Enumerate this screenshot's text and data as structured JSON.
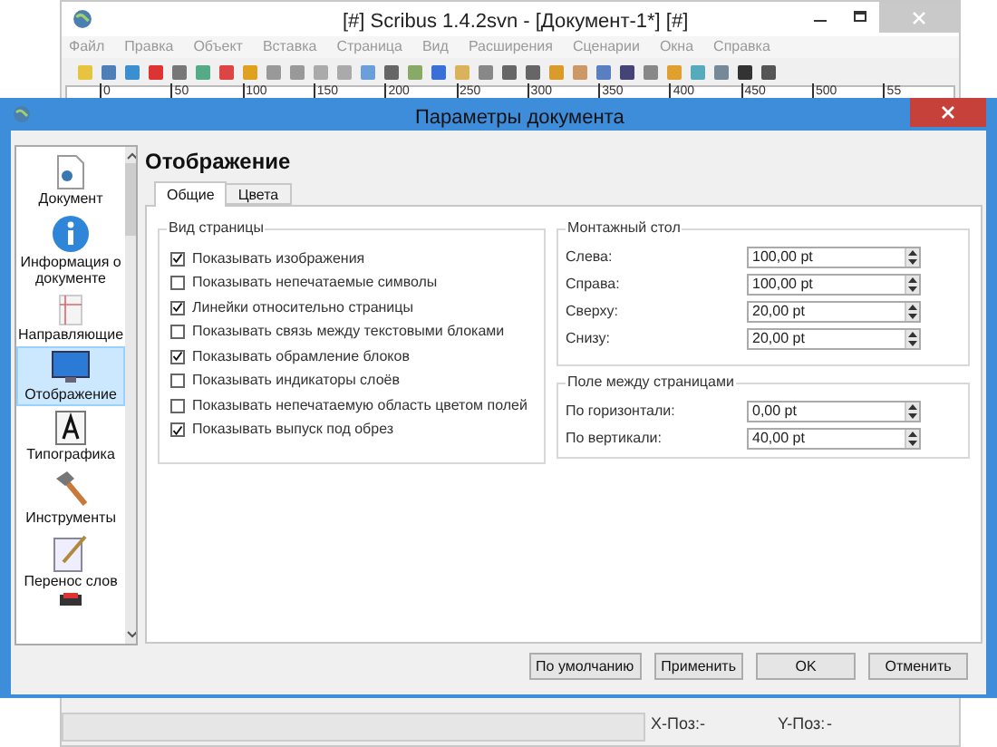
{
  "main_window": {
    "title": "[#] Scribus 1.4.2svn - [Документ-1*] [#]",
    "menu": [
      {
        "label": "Файл",
        "disabled": true
      },
      {
        "label": "Правка",
        "disabled": true
      },
      {
        "label": "Объект",
        "disabled": true
      },
      {
        "label": "Вставка",
        "disabled": true
      },
      {
        "label": "Страница",
        "disabled": true
      },
      {
        "label": "Вид",
        "disabled": true
      },
      {
        "label": "Расширения",
        "disabled": true
      },
      {
        "label": "Сценарии",
        "disabled": true
      },
      {
        "label": "Окна",
        "disabled": true
      },
      {
        "label": "Справка",
        "disabled": true
      }
    ],
    "ruler_labels": [
      "0",
      "50",
      "100",
      "150",
      "200",
      "250",
      "300",
      "350",
      "400",
      "450",
      "500",
      "55"
    ],
    "status_bar": {
      "x_label": "X-Поз:",
      "x_value": "-",
      "y_label": "Y-Поз:",
      "y_value": "-"
    }
  },
  "dialog": {
    "title": "Параметры документа",
    "sidebar": [
      {
        "label": "Документ",
        "kind": "document",
        "selected": false
      },
      {
        "label": "Информация о документе",
        "kind": "info",
        "selected": false
      },
      {
        "label": "Направляющие",
        "kind": "guides",
        "selected": false
      },
      {
        "label": "Отображение",
        "kind": "display",
        "selected": true
      },
      {
        "label": "Типографика",
        "kind": "typography",
        "selected": false
      },
      {
        "label": "Инструменты",
        "kind": "tools",
        "selected": false
      },
      {
        "label": "Перенос слов",
        "kind": "hyphen",
        "selected": false
      }
    ],
    "heading": "Отображение",
    "tabs": [
      {
        "label": "Общие",
        "selected": true
      },
      {
        "label": "Цвета",
        "selected": false
      }
    ],
    "page_view": {
      "title": "Вид страницы",
      "options": [
        {
          "label": "Показывать изображения",
          "checked": true
        },
        {
          "label": "Показывать непечатаемые символы",
          "checked": false
        },
        {
          "label": "Линейки относительно страницы",
          "checked": true
        },
        {
          "label": "Показывать связь между текстовыми блоками",
          "checked": false
        },
        {
          "label": "Показывать обрамление блоков",
          "checked": true
        },
        {
          "label": "Показывать индикаторы слоёв",
          "checked": false
        },
        {
          "label": "Показывать непечатаемую область цветом полей",
          "checked": false
        },
        {
          "label": "Показывать выпуск под обрез",
          "checked": true
        }
      ]
    },
    "scratch_space": {
      "title": "Монтажный стол",
      "fields": [
        {
          "label": "Слева:",
          "value": "100,00 pt"
        },
        {
          "label": "Справа:",
          "value": "100,00 pt"
        },
        {
          "label": "Сверху:",
          "value": "20,00 pt"
        },
        {
          "label": "Снизу:",
          "value": "20,00 pt"
        }
      ]
    },
    "gaps": {
      "title": "Поле между страницами",
      "fields": [
        {
          "label": "По горизонтали:",
          "value": "0,00 pt"
        },
        {
          "label": "По вертикали:",
          "value": "40,00 pt"
        }
      ]
    },
    "buttons": [
      "По умолчанию",
      "Применить",
      "OK",
      "Отменить"
    ]
  }
}
